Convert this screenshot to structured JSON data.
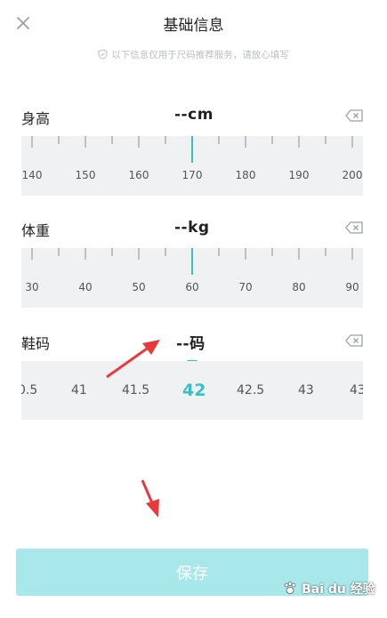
{
  "header": {
    "title": "基础信息",
    "notice": "以下信息仅用于尺码推荐服务，请放心填写",
    "close_icon": "close-icon"
  },
  "height": {
    "label": "身高",
    "value": "--cm",
    "ticks": [
      "140",
      "150",
      "160",
      "170",
      "180",
      "190",
      "200"
    ]
  },
  "weight": {
    "label": "体重",
    "value": "--kg",
    "ticks": [
      "30",
      "40",
      "50",
      "60",
      "70",
      "80",
      "90"
    ]
  },
  "shoe": {
    "label": "鞋码",
    "value": "--码",
    "sizes": [
      "0.5",
      "41",
      "41.5",
      "42",
      "42.5",
      "43",
      "43"
    ],
    "selected": "42"
  },
  "save_label": "保存",
  "watermark": "Bai du 经验",
  "colors": {
    "accent": "#35c1c9",
    "button": "#a8e8ea",
    "ruler_bg": "#f0f1f3",
    "arrow": "#e83a3a"
  }
}
